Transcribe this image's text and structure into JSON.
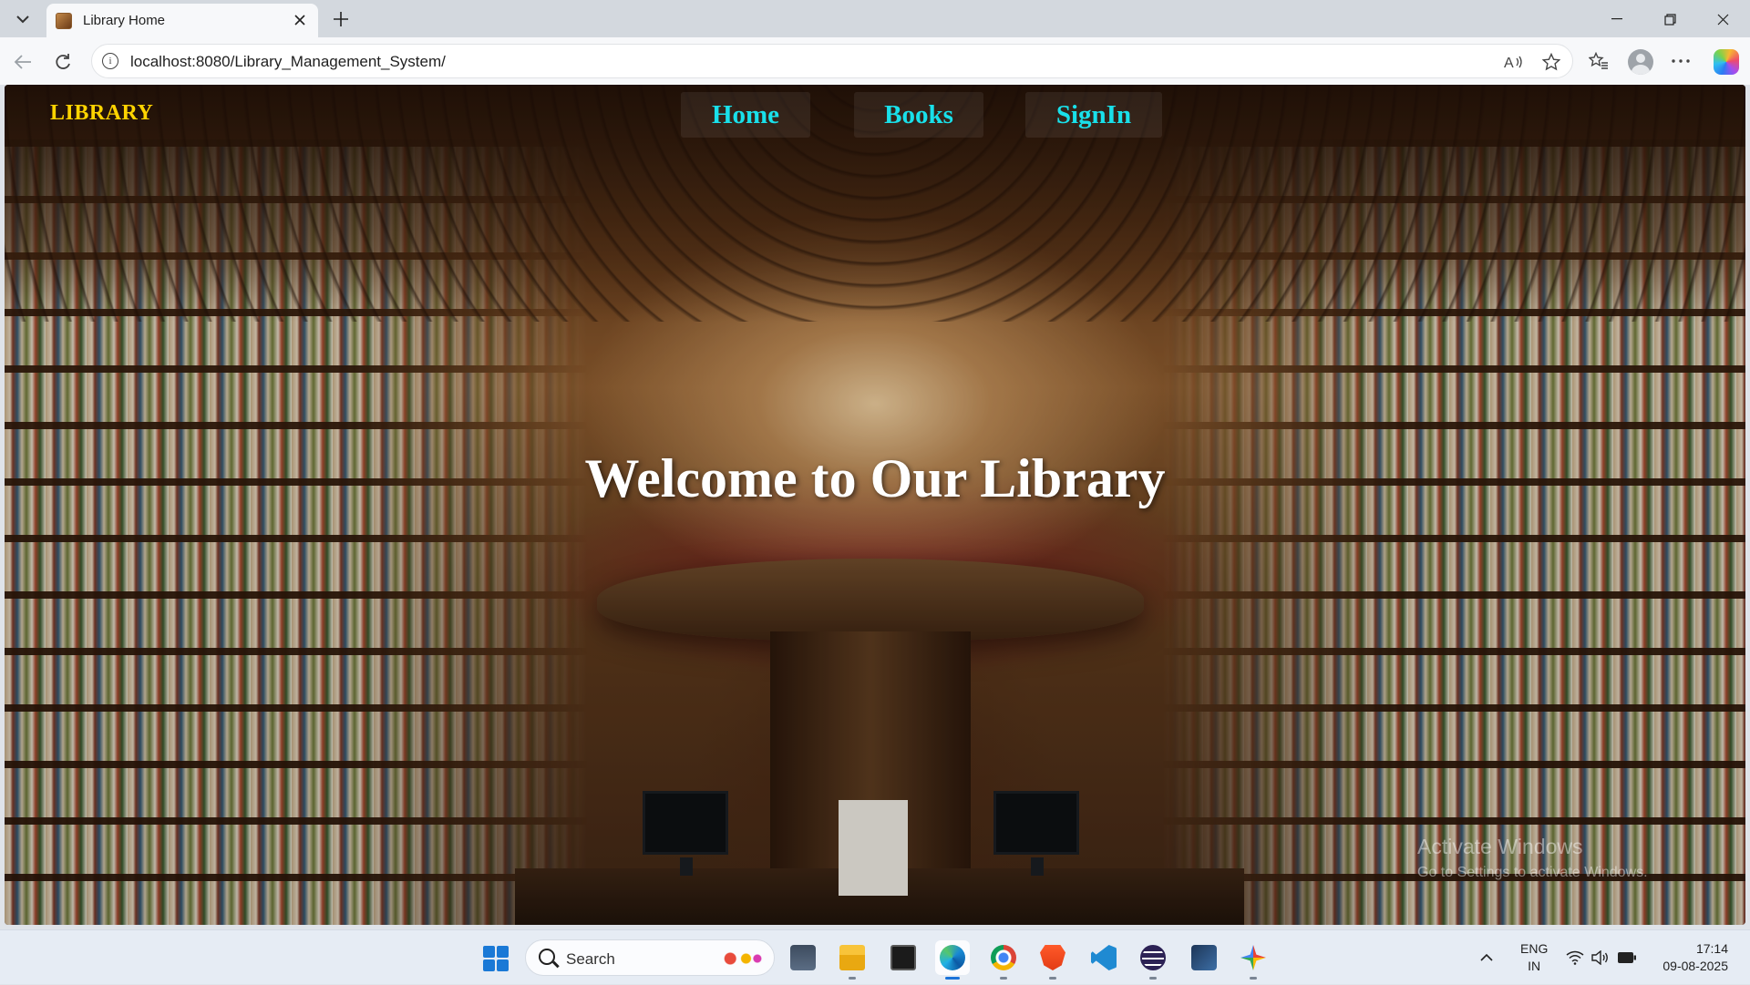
{
  "browser": {
    "tab_title": "Library Home",
    "url": "localhost:8080/Library_Management_System/",
    "icons": {
      "tab_list": "chevron-down-icon",
      "close_tab": "close-icon",
      "new_tab": "plus-icon",
      "back": "back-arrow-icon",
      "reload": "reload-icon",
      "site_info": "info-icon",
      "read_aloud": "read-aloud-icon",
      "favorite": "star-icon",
      "favorites_bar": "favorites-icon",
      "profile": "avatar",
      "more": "more-icon",
      "copilot": "copilot-icon"
    }
  },
  "page": {
    "brand": "LIBRARY",
    "nav": [
      {
        "label": "Home"
      },
      {
        "label": "Books"
      },
      {
        "label": "SignIn"
      }
    ],
    "hero_title": "Welcome to Our Library",
    "watermark_title": "Activate Windows",
    "watermark_sub": "Go to Settings to activate Windows.",
    "colors": {
      "brand": "#ffd400",
      "nav_link": "#19e0ea",
      "hero": "#ffffff"
    }
  },
  "taskbar": {
    "search_placeholder": "Search",
    "apps": [
      "start-icon",
      "widgets-icon",
      "file-explorer-icon",
      "terminal-icon",
      "edge-icon",
      "chrome-icon",
      "brave-icon",
      "vscode-icon",
      "eclipse-icon",
      "app-icon",
      "gemini-icon"
    ],
    "tray": {
      "lang_line1": "ENG",
      "lang_line2": "IN",
      "time": "17:14",
      "date": "09-08-2025"
    }
  }
}
